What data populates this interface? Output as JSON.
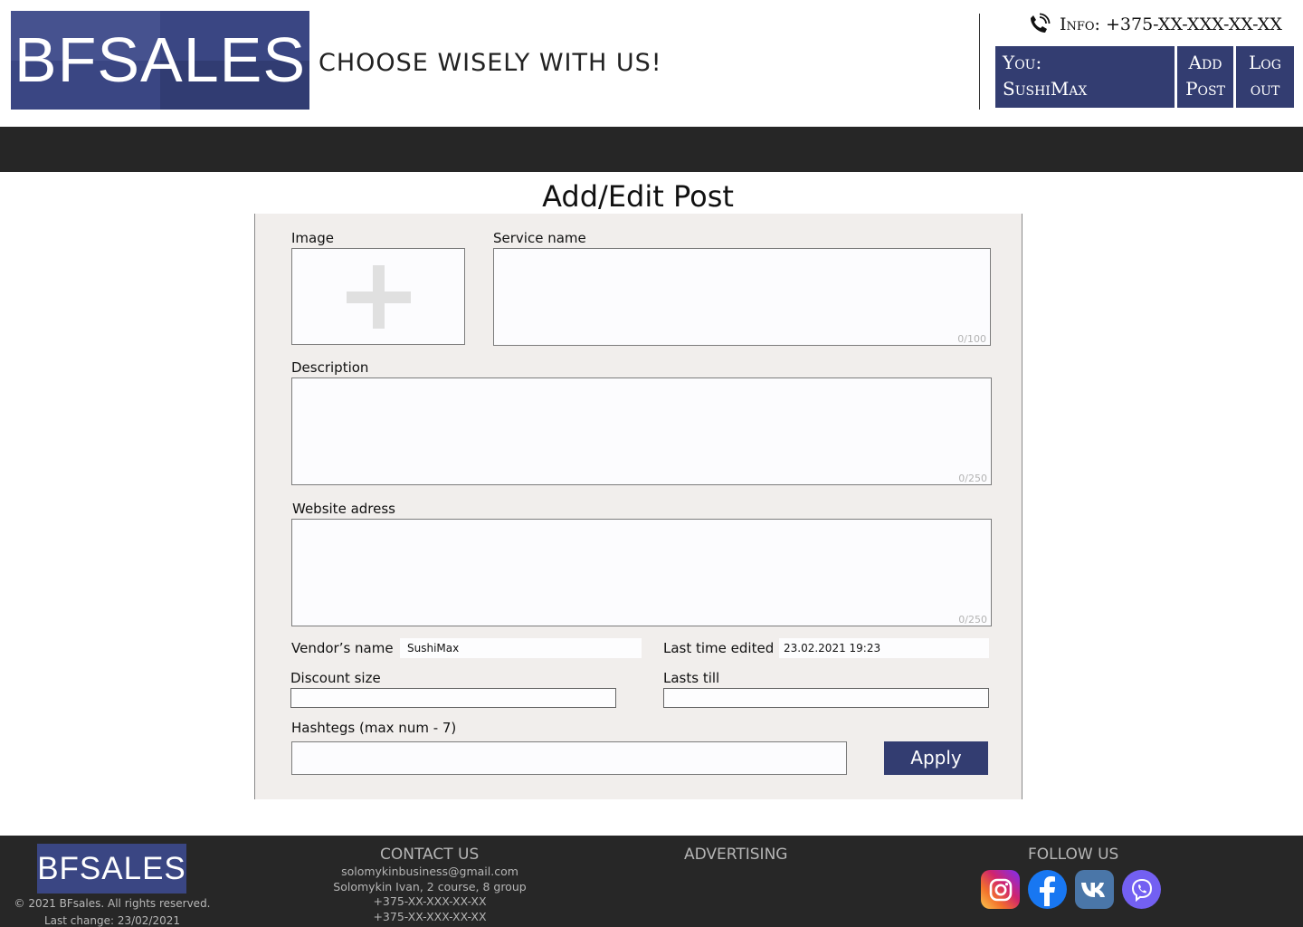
{
  "header": {
    "logo": "BFSALES",
    "slogan": "CHOOSE WISELY WITH US!",
    "phone_info": "Info: +375-XX-XXX-XX-XX",
    "user_label": "You:",
    "user_name": "SushiMax",
    "add_post_line1": "Add",
    "add_post_line2": "Post",
    "logout_line1": "Log",
    "logout_line2": "out"
  },
  "form": {
    "title": "Add/Edit Post",
    "image_label": "Image",
    "service_name_label": "Service name",
    "service_name_counter": "0/100",
    "description_label": "Description",
    "description_counter": "0/250",
    "website_label": "Website adress",
    "website_counter": "0/250",
    "vendor_label": "Vendor’s name",
    "vendor_value": "SushiMax",
    "last_edited_label": "Last time edited",
    "last_edited_value": "23.02.2021 19:23",
    "discount_label": "Discount size",
    "lasts_till_label": "Lasts till",
    "hashtags_label": "Hashtegs (max num - 7)",
    "apply_label": "Apply"
  },
  "footer": {
    "logo": "BFSALES",
    "copyright": "© 2021 BFsales. All rights reserved.",
    "last_change": "Last change: 23/02/2021",
    "contact_heading": "CONTACT US",
    "contact_email": "solomykinbusiness@gmail.com",
    "contact_name": "Solomykin Ivan, 2 course, 8 group",
    "contact_phone1": "+375-XX-XXX-XX-XX",
    "contact_phone2": "+375-XX-XXX-XX-XX",
    "advertising_heading": "ADVERTISING",
    "follow_heading": "FOLLOW US",
    "socials": [
      "instagram-icon",
      "facebook-icon",
      "vk-icon",
      "viber-icon"
    ]
  },
  "colors": {
    "brand": "#333d71",
    "dark_bar": "#262626",
    "panel": "#f1eeec"
  }
}
